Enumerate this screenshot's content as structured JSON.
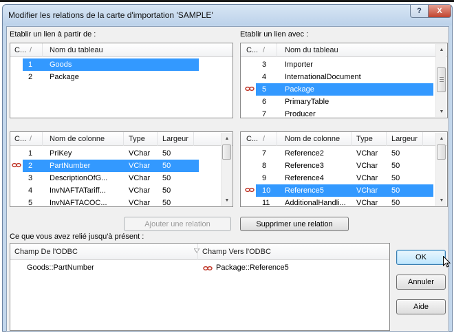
{
  "window": {
    "title": "Modifier les relations de la carte d'importation 'SAMPLE'",
    "help_glyph": "?",
    "close_glyph": "X"
  },
  "left_section": {
    "label": "Etablir un lien à partir de :",
    "tables": {
      "headers": [
        "C...",
        "/",
        "Nom du tableau"
      ],
      "rows": [
        {
          "num": "1",
          "name": "Goods",
          "selected": true
        },
        {
          "num": "2",
          "name": "Package",
          "selected": false
        }
      ]
    },
    "columns": {
      "headers": [
        "C...",
        "/",
        "Nom de colonne",
        "Type",
        "Largeur"
      ],
      "rows": [
        {
          "num": "1",
          "name": "PriKey",
          "type": "VChar",
          "width": "50",
          "linked": false,
          "selected": false
        },
        {
          "num": "2",
          "name": "PartNumber",
          "type": "VChar",
          "width": "50",
          "linked": true,
          "selected": true
        },
        {
          "num": "3",
          "name": "DescriptionOfG...",
          "type": "VChar",
          "width": "50",
          "linked": false,
          "selected": false
        },
        {
          "num": "4",
          "name": "InvNAFTATariff...",
          "type": "VChar",
          "width": "50",
          "linked": false,
          "selected": false
        },
        {
          "num": "5",
          "name": "InvNAFTACOC...",
          "type": "VChar",
          "width": "50",
          "linked": false,
          "selected": false
        }
      ]
    }
  },
  "right_section": {
    "label": "Etablir un lien avec :",
    "tables": {
      "headers": [
        "C...",
        "/",
        "Nom du tableau"
      ],
      "rows": [
        {
          "num": "3",
          "name": "Importer",
          "linked": false,
          "selected": false
        },
        {
          "num": "4",
          "name": "InternationalDocument",
          "linked": false,
          "selected": false
        },
        {
          "num": "5",
          "name": "Package",
          "linked": true,
          "selected": true
        },
        {
          "num": "6",
          "name": "PrimaryTable",
          "linked": false,
          "selected": false
        },
        {
          "num": "7",
          "name": "Producer",
          "linked": false,
          "selected": false
        }
      ]
    },
    "columns": {
      "headers": [
        "C...",
        "/",
        "Nom de colonne",
        "Type",
        "Largeur"
      ],
      "rows": [
        {
          "num": "7",
          "name": "Reference2",
          "type": "VChar",
          "width": "50",
          "linked": false,
          "selected": false
        },
        {
          "num": "8",
          "name": "Reference3",
          "type": "VChar",
          "width": "50",
          "linked": false,
          "selected": false
        },
        {
          "num": "9",
          "name": "Reference4",
          "type": "VChar",
          "width": "50",
          "linked": false,
          "selected": false
        },
        {
          "num": "10",
          "name": "Reference5",
          "type": "VChar",
          "width": "50",
          "linked": true,
          "selected": true
        },
        {
          "num": "11",
          "name": "AdditionalHandli...",
          "type": "VChar",
          "width": "50",
          "linked": false,
          "selected": false
        }
      ]
    }
  },
  "buttons": {
    "add_relation": "Ajouter une relation",
    "remove_relation": "Supprimer une relation",
    "ok": "OK",
    "cancel": "Annuler",
    "help": "Aide"
  },
  "relations": {
    "label": "Ce que vous avez relié jusqu'à présent :",
    "headers": [
      "Champ De l'ODBC",
      "Champ Vers l'ODBC"
    ],
    "rows": [
      {
        "from": "Goods::PartNumber",
        "to": "Package::Reference5"
      }
    ]
  },
  "icons": {
    "link": "chain-link-icon",
    "colors": {
      "link": "#c0392b",
      "selection": "#3399ff"
    }
  }
}
